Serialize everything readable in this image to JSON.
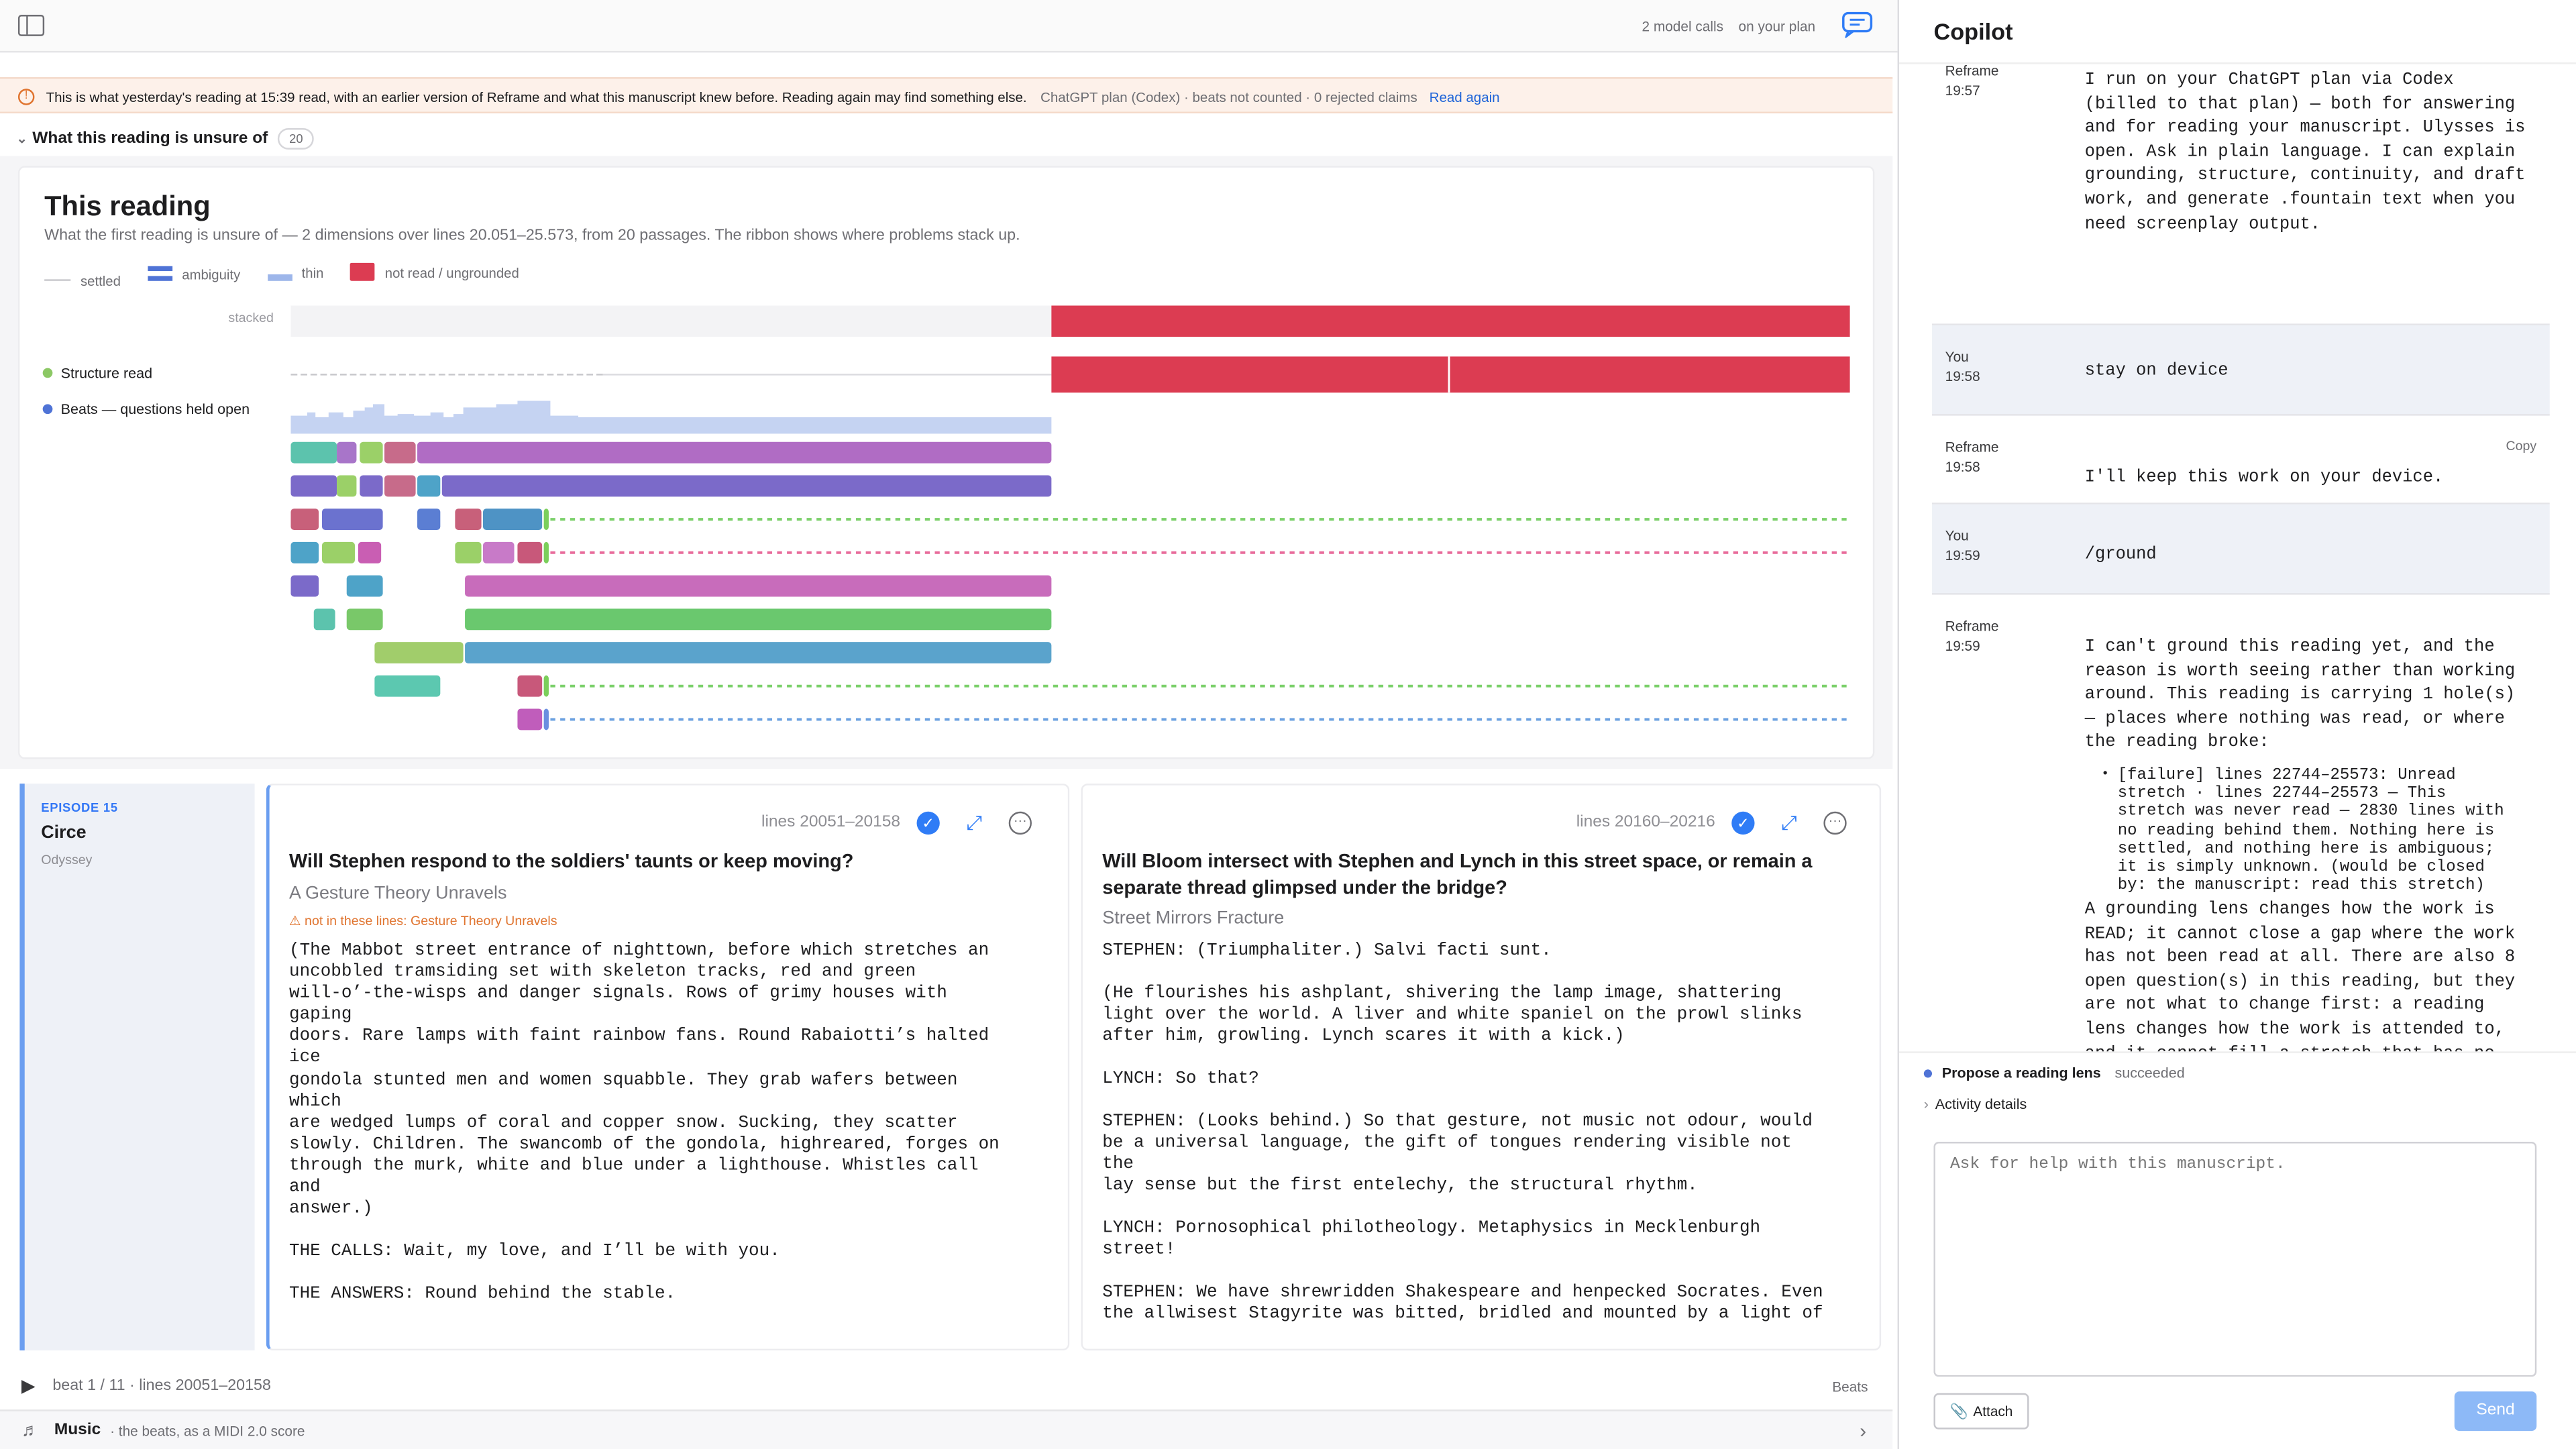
{
  "topbar": {
    "model_calls": "2 model calls",
    "plan": "on your plan"
  },
  "banner": {
    "text": "This is what yesterday's reading at 15:39 read, with an earlier version of Reframe and what this manuscript knew before. Reading again may find something else.",
    "meta": "ChatGPT plan (Codex) · beats not counted · 0 rejected claims",
    "link": "Read again"
  },
  "unsure": {
    "label": "What this reading is unsure of",
    "count": "20"
  },
  "reading": {
    "title": "This reading",
    "subtitle": "What the first reading is unsure of — 2 dimensions over lines 20.051–25.573, from 20 passages. The ribbon shows where problems stack up.",
    "legend": [
      "settled",
      "ambiguity",
      "thin",
      "not read / ungrounded"
    ],
    "stacked_label": "stacked",
    "rows": [
      "Structure read",
      "Beats — questions held open"
    ],
    "colors": {
      "settled": "#c8c8cc",
      "ambiguity": "#4f73d6",
      "thin": "#9db6ea",
      "ungrounded": "#dc3c52"
    }
  },
  "episode": {
    "number": "EPISODE 15",
    "name": "Circe",
    "book": "Odyssey"
  },
  "beat1": {
    "lines": "lines 20051–20158",
    "question": "Will Stephen respond to the soldiers' taunts or keep moving?",
    "subtitle": "A Gesture Theory Unravels",
    "warning": "not in these lines: Gesture Theory Unravels",
    "p1": "(The Mabbot street entrance of nighttown, before which stretches an\nuncobbled tramsiding set with skeleton tracks, red and green\nwill-o’-the-wisps and danger signals. Rows of grimy houses with\ngaping\ndoors. Rare lamps with faint rainbow fans. Round Rabaiotti’s halted\nice\ngondola stunted men and women squabble. They grab wafers between\nwhich\nare wedged lumps of coral and copper snow. Sucking, they scatter\nslowly. Children. The swancomb of the gondola, highreared, forges on\nthrough the murk, white and blue under a lighthouse. Whistles call\nand\nanswer.)",
    "p2": "THE CALLS: Wait, my love, and I’ll be with you.",
    "p3": "THE ANSWERS: Round behind the stable."
  },
  "beat2": {
    "lines": "lines 20160–20216",
    "question": "Will Bloom intersect with Stephen and Lynch in this street space, or remain a separate thread glimpsed under the bridge?",
    "subtitle": "Street Mirrors Fracture",
    "p1": "STEPHEN: (Triumphaliter.) Salvi facti sunt.",
    "p2": "(He flourishes his ashplant, shivering the lamp image, shattering\nlight over the world. A liver and white spaniel on the prowl slinks\nafter him, growling. Lynch scares it with a kick.)",
    "p3": "LYNCH: So that?",
    "p4": "STEPHEN: (Looks behind.) So that gesture, not music not odour, would\nbe a universal language, the gift of tongues rendering visible not\nthe\nlay sense but the first entelechy, the structural rhythm.",
    "p5": "LYNCH: Pornosophical philotheology. Metaphysics in Mecklenburgh\nstreet!",
    "p6": "STEPHEN: We have shrewridden Shakespeare and henpecked Socrates. Even\nthe allwisest Stagyrite was bitted, bridled and mounted by a light of"
  },
  "footer": {
    "beat_status": "beat 1 / 11 · lines 20051–20158",
    "beats_label": "Beats",
    "music_title": "Music",
    "music_sub": "· the beats, as a MIDI 2.0 score"
  },
  "copilot": {
    "title": "Copilot",
    "messages": [
      {
        "who": "Reframe",
        "time": "19:57",
        "text": "I run on your ChatGPT plan via Codex\n(billed to that plan) — both for answering\nand for reading your manuscript. Ulysses is\nopen. Ask in plain language. I can explain\ngrounding, structure, continuity, and draft\nwork, and generate .fountain text when you\nneed screenplay output."
      },
      {
        "who": "You",
        "time": "19:58",
        "text": "stay on device"
      },
      {
        "who": "Reframe",
        "time": "19:58",
        "text": "I'll keep this work on your device.",
        "action": "Copy"
      },
      {
        "who": "You",
        "time": "19:59",
        "text": "/ground"
      },
      {
        "who": "Reframe",
        "time": "19:59",
        "text": "I can't ground this reading yet, and the\nreason is worth seeing rather than working\naround. This reading is carrying 1 hole(s)\n— places where nothing was read, or where\nthe reading broke:",
        "bullet": "[failure] lines 22744–25573: Unread\nstretch · lines 22744–25573 — This\nstretch was never read — 2830 lines with\nno reading behind them. Nothing here is\nsettled, and nothing here is ambiguous;\nit is simply unknown. (would be closed\nby: the manuscript: read this stretch)",
        "text2": "A grounding lens changes how the work is\nREAD; it cannot close a gap where the work\nhas not been read at all. There are also 8\nopen question(s) in this reading, but they\nare not what to change first: a reading\nlens changes how the work is attended to,\nand it cannot fill a stretch that has no\nreading behind it. Nothing has changed."
      }
    ],
    "activity": {
      "label": "Propose a reading lens",
      "status": "succeeded"
    },
    "details": "Activity details",
    "input_placeholder": "Ask for help with this manuscript.",
    "attach": "Attach",
    "send": "Send"
  }
}
